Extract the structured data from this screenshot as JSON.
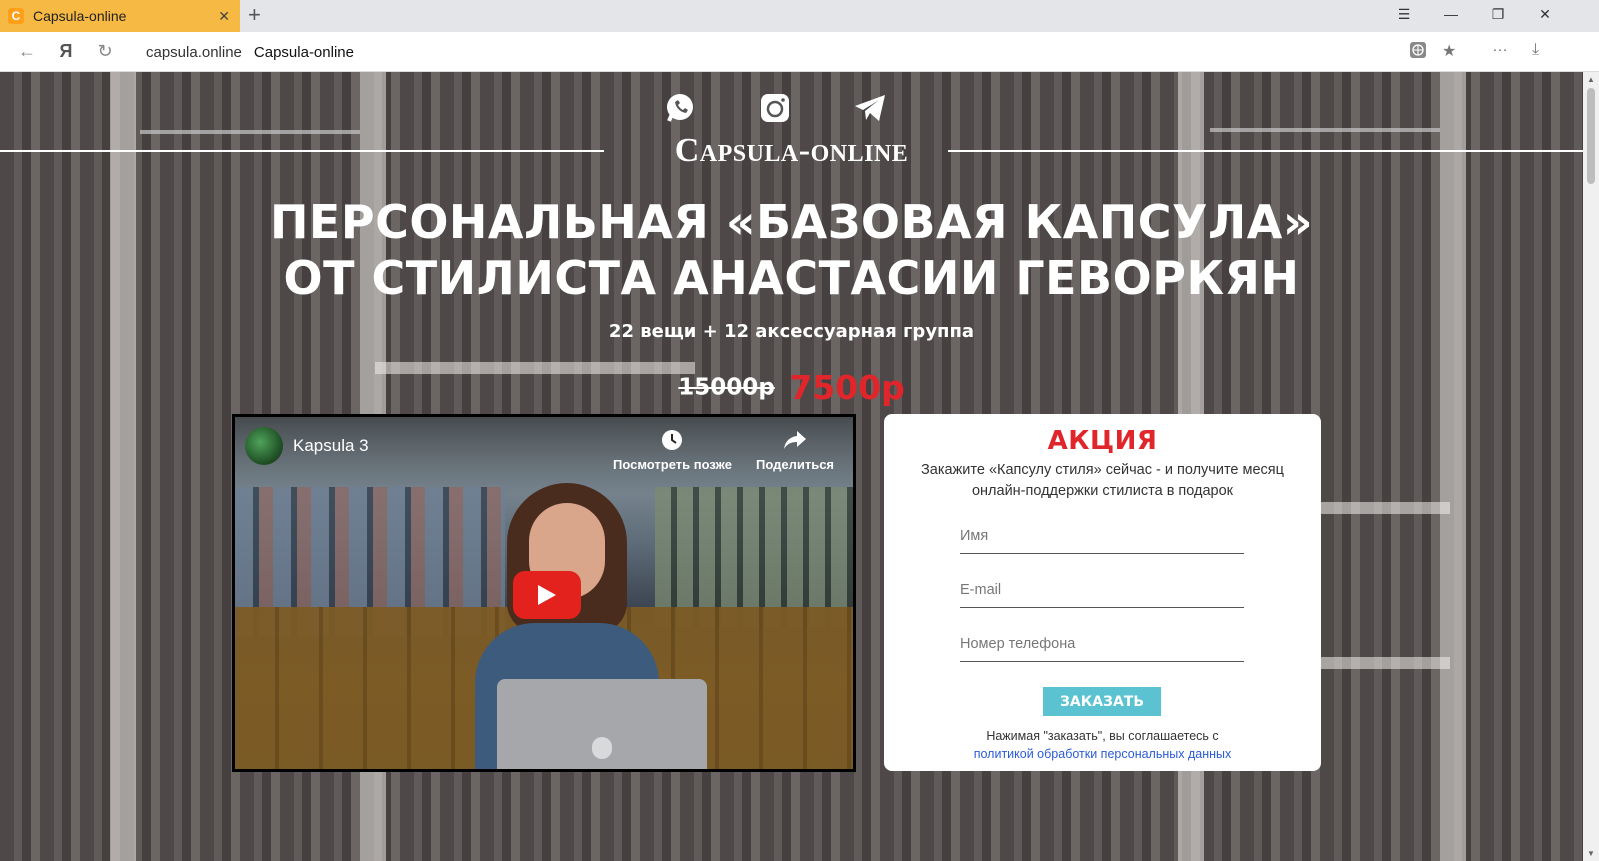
{
  "browser": {
    "tab_title": "Capsula-online",
    "tab_favicon_letter": "C",
    "address_domain": "capsula.online",
    "address_title": "Capsula-online"
  },
  "page": {
    "logo": "Capsula-online",
    "headline_line1": "ПЕРСОНАЛЬНАЯ «БАЗОВАЯ КАПСУЛА»",
    "headline_line2": "ОТ СТИЛИСТА АНАСТАСИИ ГЕВОРКЯН",
    "subline": "22 вещи + 12 аксессуарная группа",
    "old_price": "15000р",
    "new_price": "7500р"
  },
  "video": {
    "title": "Kapsula 3",
    "watch_later": "Посмотреть позже",
    "share": "Поделиться"
  },
  "form": {
    "title": "АКЦИЯ",
    "desc_line1": "Закажите «Капсулу стиля» сейчас - и получите месяц",
    "desc_line2": "онлайн-поддержки стилиста в подарок",
    "name_placeholder": "Имя",
    "email_placeholder": "E-mail",
    "phone_placeholder": "Номер телефона",
    "submit": "ЗАКАЗАТЬ",
    "consent_text": "Нажимая \"заказать\", вы соглашаетесь с",
    "consent_link": "политикой обработки персональных данных"
  },
  "colors": {
    "tab_active": "#f6b944",
    "price_red": "#e1262b",
    "button_teal": "#5bc2d1",
    "link_blue": "#2a5bd7"
  }
}
